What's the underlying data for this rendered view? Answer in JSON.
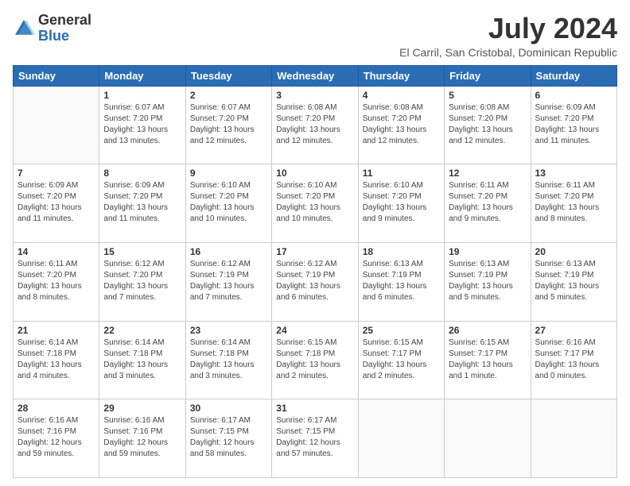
{
  "logo": {
    "general": "General",
    "blue": "Blue"
  },
  "header": {
    "month_year": "July 2024",
    "location": "El Carril, San Cristobal, Dominican Republic"
  },
  "days_of_week": [
    "Sunday",
    "Monday",
    "Tuesday",
    "Wednesday",
    "Thursday",
    "Friday",
    "Saturday"
  ],
  "weeks": [
    [
      {
        "day": "",
        "sunrise": "",
        "sunset": "",
        "daylight": ""
      },
      {
        "day": "1",
        "sunrise": "6:07 AM",
        "sunset": "7:20 PM",
        "daylight": "13 hours and 13 minutes."
      },
      {
        "day": "2",
        "sunrise": "6:07 AM",
        "sunset": "7:20 PM",
        "daylight": "13 hours and 12 minutes."
      },
      {
        "day": "3",
        "sunrise": "6:08 AM",
        "sunset": "7:20 PM",
        "daylight": "13 hours and 12 minutes."
      },
      {
        "day": "4",
        "sunrise": "6:08 AM",
        "sunset": "7:20 PM",
        "daylight": "13 hours and 12 minutes."
      },
      {
        "day": "5",
        "sunrise": "6:08 AM",
        "sunset": "7:20 PM",
        "daylight": "13 hours and 12 minutes."
      },
      {
        "day": "6",
        "sunrise": "6:09 AM",
        "sunset": "7:20 PM",
        "daylight": "13 hours and 11 minutes."
      }
    ],
    [
      {
        "day": "7",
        "sunrise": "6:09 AM",
        "sunset": "7:20 PM",
        "daylight": "13 hours and 11 minutes."
      },
      {
        "day": "8",
        "sunrise": "6:09 AM",
        "sunset": "7:20 PM",
        "daylight": "13 hours and 11 minutes."
      },
      {
        "day": "9",
        "sunrise": "6:10 AM",
        "sunset": "7:20 PM",
        "daylight": "13 hours and 10 minutes."
      },
      {
        "day": "10",
        "sunrise": "6:10 AM",
        "sunset": "7:20 PM",
        "daylight": "13 hours and 10 minutes."
      },
      {
        "day": "11",
        "sunrise": "6:10 AM",
        "sunset": "7:20 PM",
        "daylight": "13 hours and 9 minutes."
      },
      {
        "day": "12",
        "sunrise": "6:11 AM",
        "sunset": "7:20 PM",
        "daylight": "13 hours and 9 minutes."
      },
      {
        "day": "13",
        "sunrise": "6:11 AM",
        "sunset": "7:20 PM",
        "daylight": "13 hours and 8 minutes."
      }
    ],
    [
      {
        "day": "14",
        "sunrise": "6:11 AM",
        "sunset": "7:20 PM",
        "daylight": "13 hours and 8 minutes."
      },
      {
        "day": "15",
        "sunrise": "6:12 AM",
        "sunset": "7:20 PM",
        "daylight": "13 hours and 7 minutes."
      },
      {
        "day": "16",
        "sunrise": "6:12 AM",
        "sunset": "7:19 PM",
        "daylight": "13 hours and 7 minutes."
      },
      {
        "day": "17",
        "sunrise": "6:12 AM",
        "sunset": "7:19 PM",
        "daylight": "13 hours and 6 minutes."
      },
      {
        "day": "18",
        "sunrise": "6:13 AM",
        "sunset": "7:19 PM",
        "daylight": "13 hours and 6 minutes."
      },
      {
        "day": "19",
        "sunrise": "6:13 AM",
        "sunset": "7:19 PM",
        "daylight": "13 hours and 5 minutes."
      },
      {
        "day": "20",
        "sunrise": "6:13 AM",
        "sunset": "7:19 PM",
        "daylight": "13 hours and 5 minutes."
      }
    ],
    [
      {
        "day": "21",
        "sunrise": "6:14 AM",
        "sunset": "7:18 PM",
        "daylight": "13 hours and 4 minutes."
      },
      {
        "day": "22",
        "sunrise": "6:14 AM",
        "sunset": "7:18 PM",
        "daylight": "13 hours and 3 minutes."
      },
      {
        "day": "23",
        "sunrise": "6:14 AM",
        "sunset": "7:18 PM",
        "daylight": "13 hours and 3 minutes."
      },
      {
        "day": "24",
        "sunrise": "6:15 AM",
        "sunset": "7:18 PM",
        "daylight": "13 hours and 2 minutes."
      },
      {
        "day": "25",
        "sunrise": "6:15 AM",
        "sunset": "7:17 PM",
        "daylight": "13 hours and 2 minutes."
      },
      {
        "day": "26",
        "sunrise": "6:15 AM",
        "sunset": "7:17 PM",
        "daylight": "13 hours and 1 minute."
      },
      {
        "day": "27",
        "sunrise": "6:16 AM",
        "sunset": "7:17 PM",
        "daylight": "13 hours and 0 minutes."
      }
    ],
    [
      {
        "day": "28",
        "sunrise": "6:16 AM",
        "sunset": "7:16 PM",
        "daylight": "12 hours and 59 minutes."
      },
      {
        "day": "29",
        "sunrise": "6:16 AM",
        "sunset": "7:16 PM",
        "daylight": "12 hours and 59 minutes."
      },
      {
        "day": "30",
        "sunrise": "6:17 AM",
        "sunset": "7:15 PM",
        "daylight": "12 hours and 58 minutes."
      },
      {
        "day": "31",
        "sunrise": "6:17 AM",
        "sunset": "7:15 PM",
        "daylight": "12 hours and 57 minutes."
      },
      {
        "day": "",
        "sunrise": "",
        "sunset": "",
        "daylight": ""
      },
      {
        "day": "",
        "sunrise": "",
        "sunset": "",
        "daylight": ""
      },
      {
        "day": "",
        "sunrise": "",
        "sunset": "",
        "daylight": ""
      }
    ]
  ]
}
